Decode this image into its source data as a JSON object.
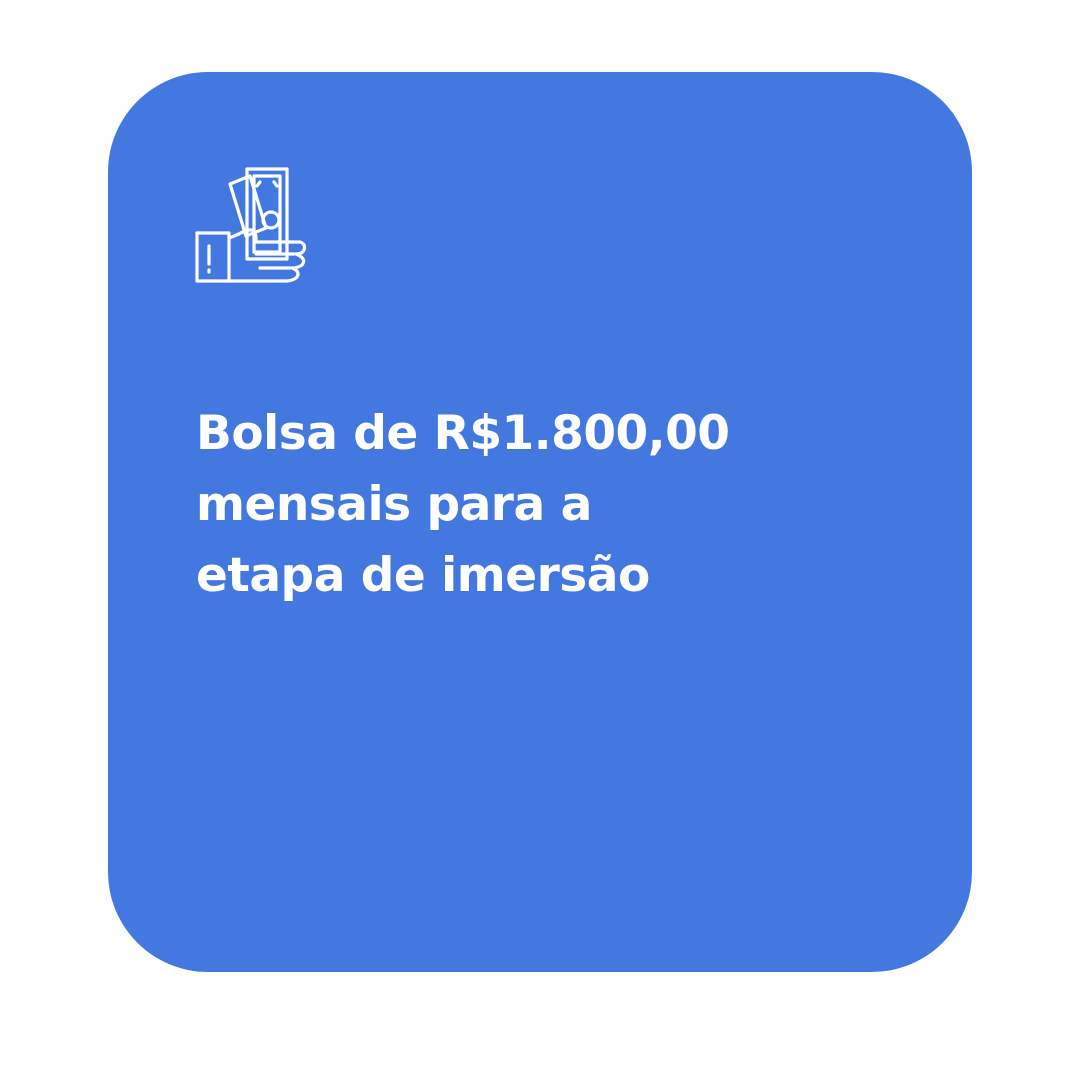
{
  "card": {
    "background_color": "#4478e1",
    "icon": "hand-holding-money-icon",
    "headline_lines": [
      "Bolsa de R$1.800,00",
      "mensais para a",
      "etapa de imersão"
    ]
  }
}
